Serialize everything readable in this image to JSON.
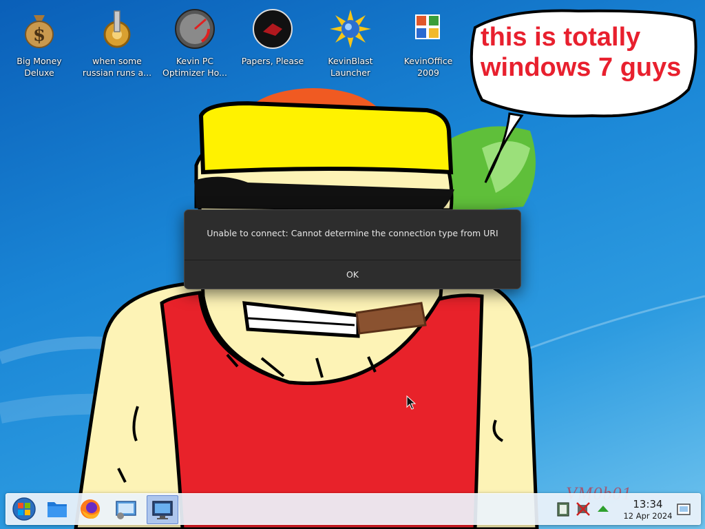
{
  "desktop_icons": [
    {
      "label": "Big Money\nDeluxe",
      "icon": "money-bag-icon"
    },
    {
      "label": "when some\nrussian runs a...",
      "icon": "cog-icon"
    },
    {
      "label": "Kevin PC\nOptimizer Ho...",
      "icon": "speedometer-icon"
    },
    {
      "label": "Papers, Please",
      "icon": "papers-please-icon"
    },
    {
      "label": "KevinBlast\nLauncher",
      "icon": "starburst-icon"
    },
    {
      "label": "KevinOffice\n2009",
      "icon": "office-logo-icon"
    }
  ],
  "speech_bubble": {
    "text": "this is totally windows 7 guys"
  },
  "dialog": {
    "message": "Unable to connect: Cannot determine the connection type from URI",
    "ok_label": "OK"
  },
  "taskbar": {
    "buttons": [
      {
        "icon": "start-orb-icon"
      },
      {
        "icon": "file-manager-icon"
      },
      {
        "icon": "firefox-icon"
      },
      {
        "icon": "system-settings-icon"
      },
      {
        "icon": "remote-desktop-icon",
        "active": true
      }
    ],
    "tray": [
      "clipboard-icon",
      "network-disconnected-icon",
      "show-hidden-icons-arrow-icon"
    ],
    "clock": {
      "time": "13:34",
      "date": "12 Apr 2024"
    },
    "watermark": "VM0b01"
  },
  "colors": {
    "bubble_text": "#e8202e",
    "dialog_bg": "#2d2d2d",
    "taskbar_bg": "#ecf2fa"
  }
}
